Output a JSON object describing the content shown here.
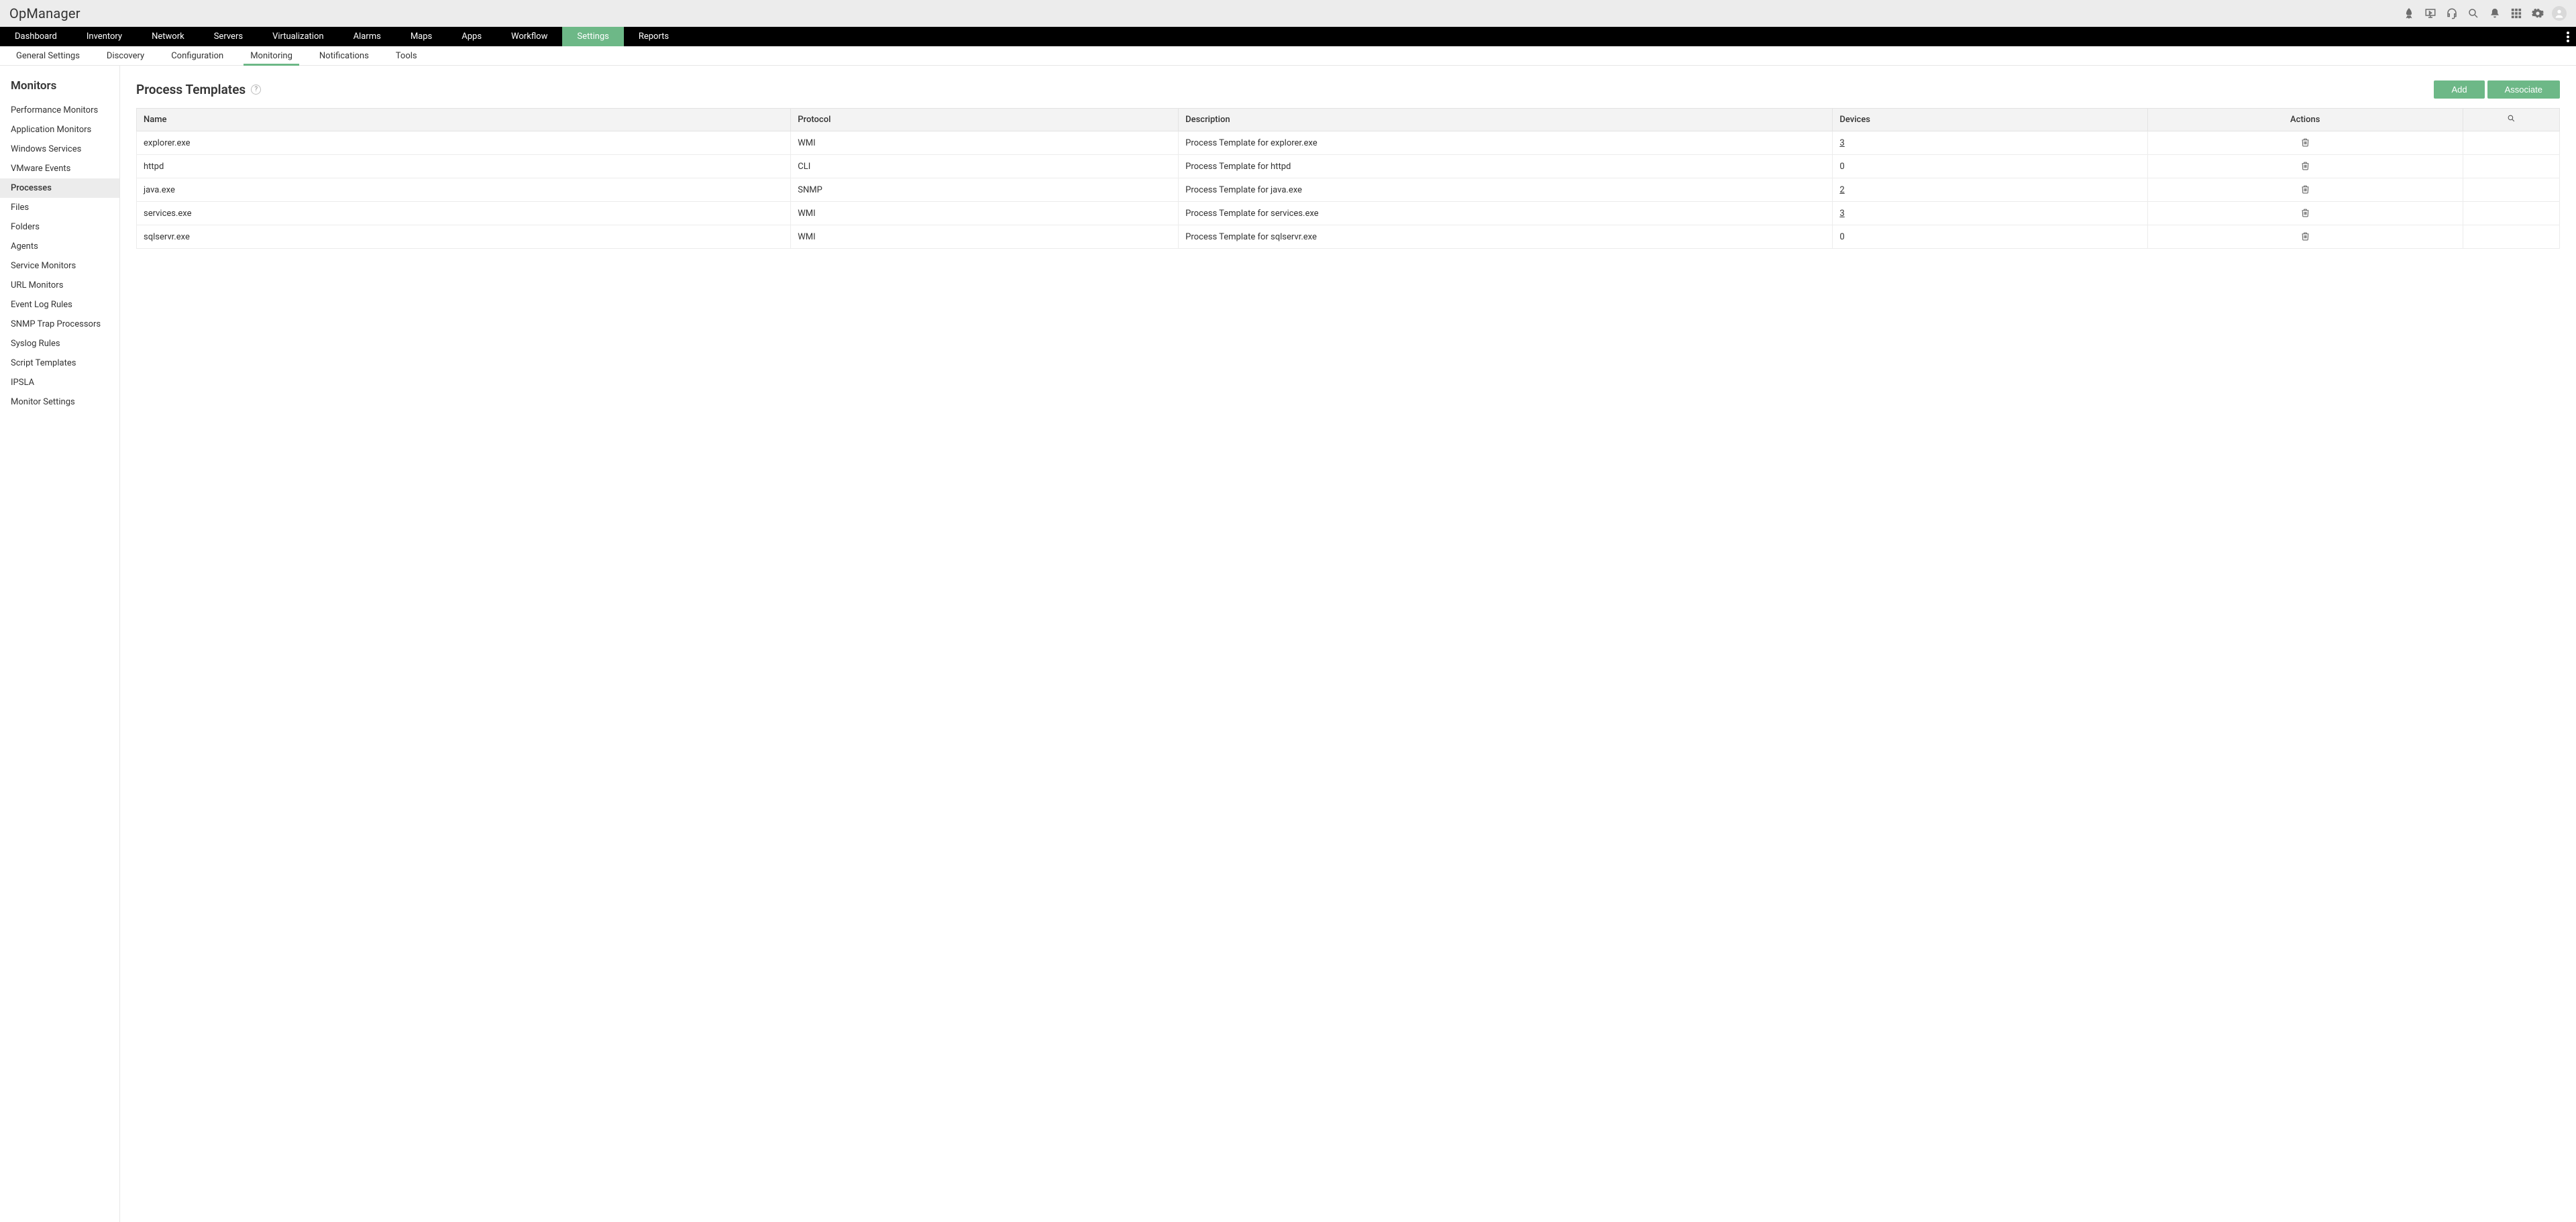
{
  "brand": "OpManager",
  "topIcons": [
    {
      "name": "rocket-icon"
    },
    {
      "name": "presentation-icon"
    },
    {
      "name": "headset-icon"
    },
    {
      "name": "search-icon"
    },
    {
      "name": "bell-icon"
    },
    {
      "name": "apps-grid-icon"
    },
    {
      "name": "gear-icon"
    }
  ],
  "primaryNav": [
    "Dashboard",
    "Inventory",
    "Network",
    "Servers",
    "Virtualization",
    "Alarms",
    "Maps",
    "Apps",
    "Workflow",
    "Settings",
    "Reports"
  ],
  "primaryNavActiveIndex": 9,
  "subNav": [
    "General Settings",
    "Discovery",
    "Configuration",
    "Monitoring",
    "Notifications",
    "Tools"
  ],
  "subNavActiveIndex": 3,
  "sidebar": {
    "title": "Monitors",
    "items": [
      "Performance Monitors",
      "Application Monitors",
      "Windows Services",
      "VMware Events",
      "Processes",
      "Files",
      "Folders",
      "Agents",
      "Service Monitors",
      "URL Monitors",
      "Event Log Rules",
      "SNMP Trap Processors",
      "Syslog Rules",
      "Script Templates",
      "IPSLA",
      "Monitor Settings"
    ],
    "activeIndex": 4
  },
  "page": {
    "title": "Process Templates",
    "help": "?",
    "buttons": {
      "add": "Add",
      "associate": "Associate"
    }
  },
  "table": {
    "columns": {
      "name": "Name",
      "protocol": "Protocol",
      "description": "Description",
      "devices": "Devices",
      "actions": "Actions"
    },
    "rows": [
      {
        "name": "explorer.exe",
        "protocol": "WMI",
        "description": "Process Template for explorer.exe",
        "devices": "3",
        "devicesLink": true
      },
      {
        "name": "httpd",
        "protocol": "CLI",
        "description": "Process Template for httpd",
        "devices": "0",
        "devicesLink": false
      },
      {
        "name": "java.exe",
        "protocol": "SNMP",
        "description": "Process Template for java.exe",
        "devices": "2",
        "devicesLink": true
      },
      {
        "name": "services.exe",
        "protocol": "WMI",
        "description": "Process Template for services.exe",
        "devices": "3",
        "devicesLink": true
      },
      {
        "name": "sqlservr.exe",
        "protocol": "WMI",
        "description": "Process Template for sqlservr.exe",
        "devices": "0",
        "devicesLink": false
      }
    ]
  }
}
